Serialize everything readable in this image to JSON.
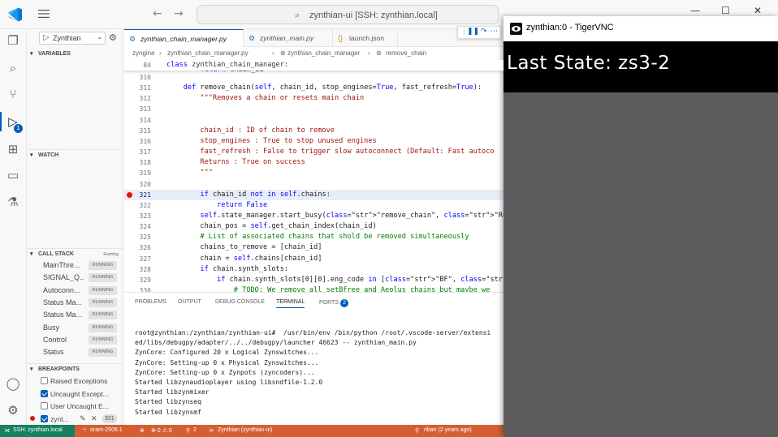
{
  "search": {
    "text": "zynthian-ui [SSH: zynthian.local]"
  },
  "window": {
    "minimize": "—",
    "maximize": "☐",
    "close": "✕"
  },
  "debug": {
    "config_name": "Zynthian"
  },
  "sidebar": {
    "sections": {
      "variables": "VARIABLES",
      "watch": "WATCH",
      "call_stack": "CALL STACK",
      "call_stack_status": "Running",
      "breakpoints": "BREAKPOINTS"
    },
    "call_stack": [
      {
        "name": "MainThre...",
        "status": "RUNNING"
      },
      {
        "name": "SIGNAL_Q...",
        "status": "RUNNING"
      },
      {
        "name": "Autoconn...",
        "status": "RUNNING"
      },
      {
        "name": "Status Ma...",
        "status": "RUNNING"
      },
      {
        "name": "Status Ma...",
        "status": "RUNNING"
      },
      {
        "name": "Busy",
        "status": "RUNNING"
      },
      {
        "name": "Control",
        "status": "RUNNING"
      },
      {
        "name": "Status",
        "status": "RUNNING"
      }
    ],
    "breakpoints": [
      {
        "label": "Raised Exceptions",
        "checked": false
      },
      {
        "label": "Uncaught Except...",
        "checked": true
      },
      {
        "label": "User Uncaught E...",
        "checked": false
      },
      {
        "label": "zynt...",
        "checked": true,
        "line": "321"
      }
    ]
  },
  "tabs": [
    {
      "label": "zynthian_chain_manager.py",
      "active": true
    },
    {
      "label": "zynthian_main.py",
      "active": false
    },
    {
      "label": "launch.json",
      "active": false
    }
  ],
  "breadcrumb": [
    "zyngine",
    "zynthian_chain_manager.py",
    "zynthian_chain_manager",
    "remove_chain"
  ],
  "code": {
    "sticky": {
      "line": "84",
      "text": "class zynthian_chain_manager:"
    },
    "partial_line": "return chain_id",
    "lines": [
      {
        "n": "310",
        "t": ""
      },
      {
        "n": "311",
        "t": "    def remove_chain(self, chain_id, stop_engines=True, fast_refresh=True):"
      },
      {
        "n": "312",
        "t": "        \"\"\"Removes a chain or resets main chain"
      },
      {
        "n": "313",
        "t": ""
      },
      {
        "n": "314",
        "t": ""
      },
      {
        "n": "315",
        "t": "        chain_id : ID of chain to remove"
      },
      {
        "n": "316",
        "t": "        stop_engines : True to stop unused engines"
      },
      {
        "n": "317",
        "t": "        fast_refresh : False to trigger slow autoconnect (Default: Fast autoco"
      },
      {
        "n": "318",
        "t": "        Returns : True on success"
      },
      {
        "n": "319",
        "t": "        \"\"\""
      },
      {
        "n": "320",
        "t": ""
      },
      {
        "n": "321",
        "t": "        if chain_id not in self.chains:"
      },
      {
        "n": "322",
        "t": "            return False"
      },
      {
        "n": "323",
        "t": "        self.state_manager.start_busy(\"remove_chain\", \"Removing Chain\")"
      },
      {
        "n": "324",
        "t": "        chain_pos = self.get_chain_index(chain_id)"
      },
      {
        "n": "325",
        "t": "        # List of associated chains that shold be removed simultaneously"
      },
      {
        "n": "326",
        "t": "        chains_to_remove = [chain_id]"
      },
      {
        "n": "327",
        "t": "        chain = self.chains[chain_id]"
      },
      {
        "n": "328",
        "t": "        if chain.synth_slots:"
      },
      {
        "n": "329",
        "t": "            if chain.synth_slots[0][0].eng_code in [\"BF\", \"AE\"]:"
      },
      {
        "n": "330",
        "t": "                # TODO: We remove all setBfree and Aeolus chains but maybe we"
      }
    ]
  },
  "panel": {
    "tabs": [
      "PROBLEMS",
      "OUTPUT",
      "DEBUG CONSOLE",
      "TERMINAL",
      "PORTS"
    ],
    "ports_badge": "2",
    "terminal": [
      "root@zynthian:/zynthian/zynthian-ui#  /usr/bin/env /bin/python /root/.vscode-server/extensi",
      "ed/libs/debugpy/adapter/../../debugpy/launcher 46623 -- zynthian_main.py",
      "ZynCore: Configured 20 x Logical Zynswitches...",
      "ZynCore: Setting-up 0 x Physical Zynswitches...",
      "ZynCore: Setting-up 0 x Zynpots (zyncoders)...",
      "Started libzynaudioplayer using libsndfile-1.2.0",
      "Started libzynmixer",
      "Started libzynseq",
      "Started libzynsmf"
    ]
  },
  "status": {
    "remote": "SSH: zynthian.local",
    "branch": "oram-2506.1",
    "sync": "⊗",
    "problems": "⊗ 0 ⚠ 0",
    "ports": "2",
    "debug": "Zynthian (zynthian-ui)",
    "blame": "riban (2 years ago)"
  },
  "vnc": {
    "title": "zynthian:0 - TigerVNC",
    "state": "Last State: zs3-2"
  },
  "colors": {
    "accent": "#005fb8",
    "statusbar": "#d55f33",
    "remote": "#16825d",
    "breakpoint": "#e51400"
  }
}
